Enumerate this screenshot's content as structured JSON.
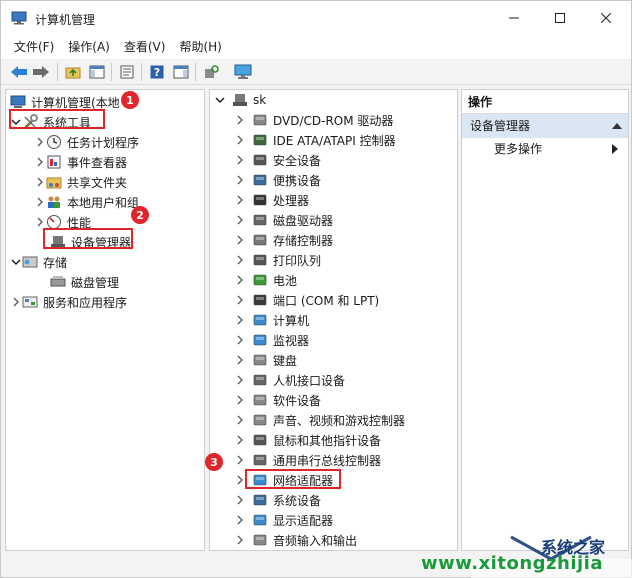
{
  "window": {
    "title": "计算机管理"
  },
  "menu": [
    "文件(F)",
    "操作(A)",
    "查看(V)",
    "帮助(H)"
  ],
  "left_tree": {
    "root": "计算机管理(本地",
    "system_tools": "系统工具",
    "system_children": [
      "任务计划程序",
      "事件查看器",
      "共享文件夹",
      "本地用户和组",
      "性能",
      "设备管理器"
    ],
    "storage": "存储",
    "disk_mgmt": "磁盘管理",
    "services": "服务和应用程序"
  },
  "device_tree": {
    "root": "sk",
    "items": [
      "DVD/CD-ROM 驱动器",
      "IDE ATA/ATAPI 控制器",
      "安全设备",
      "便携设备",
      "处理器",
      "磁盘驱动器",
      "存储控制器",
      "打印队列",
      "电池",
      "端口 (COM 和 LPT)",
      "计算机",
      "监视器",
      "键盘",
      "人机接口设备",
      "软件设备",
      "声音、视频和游戏控制器",
      "鼠标和其他指针设备",
      "通用串行总线控制器",
      "网络适配器",
      "系统设备",
      "显示适配器",
      "音频输入和输出"
    ]
  },
  "actions": {
    "header": "操作",
    "section": "设备管理器",
    "more": "更多操作"
  },
  "badges": [
    "1",
    "2",
    "3"
  ],
  "watermark": {
    "brand": "系统之家",
    "url": "www.xitongzhijia"
  },
  "colors": {
    "highlight": "#e0262b",
    "section_bg": "#dbe6f4"
  }
}
